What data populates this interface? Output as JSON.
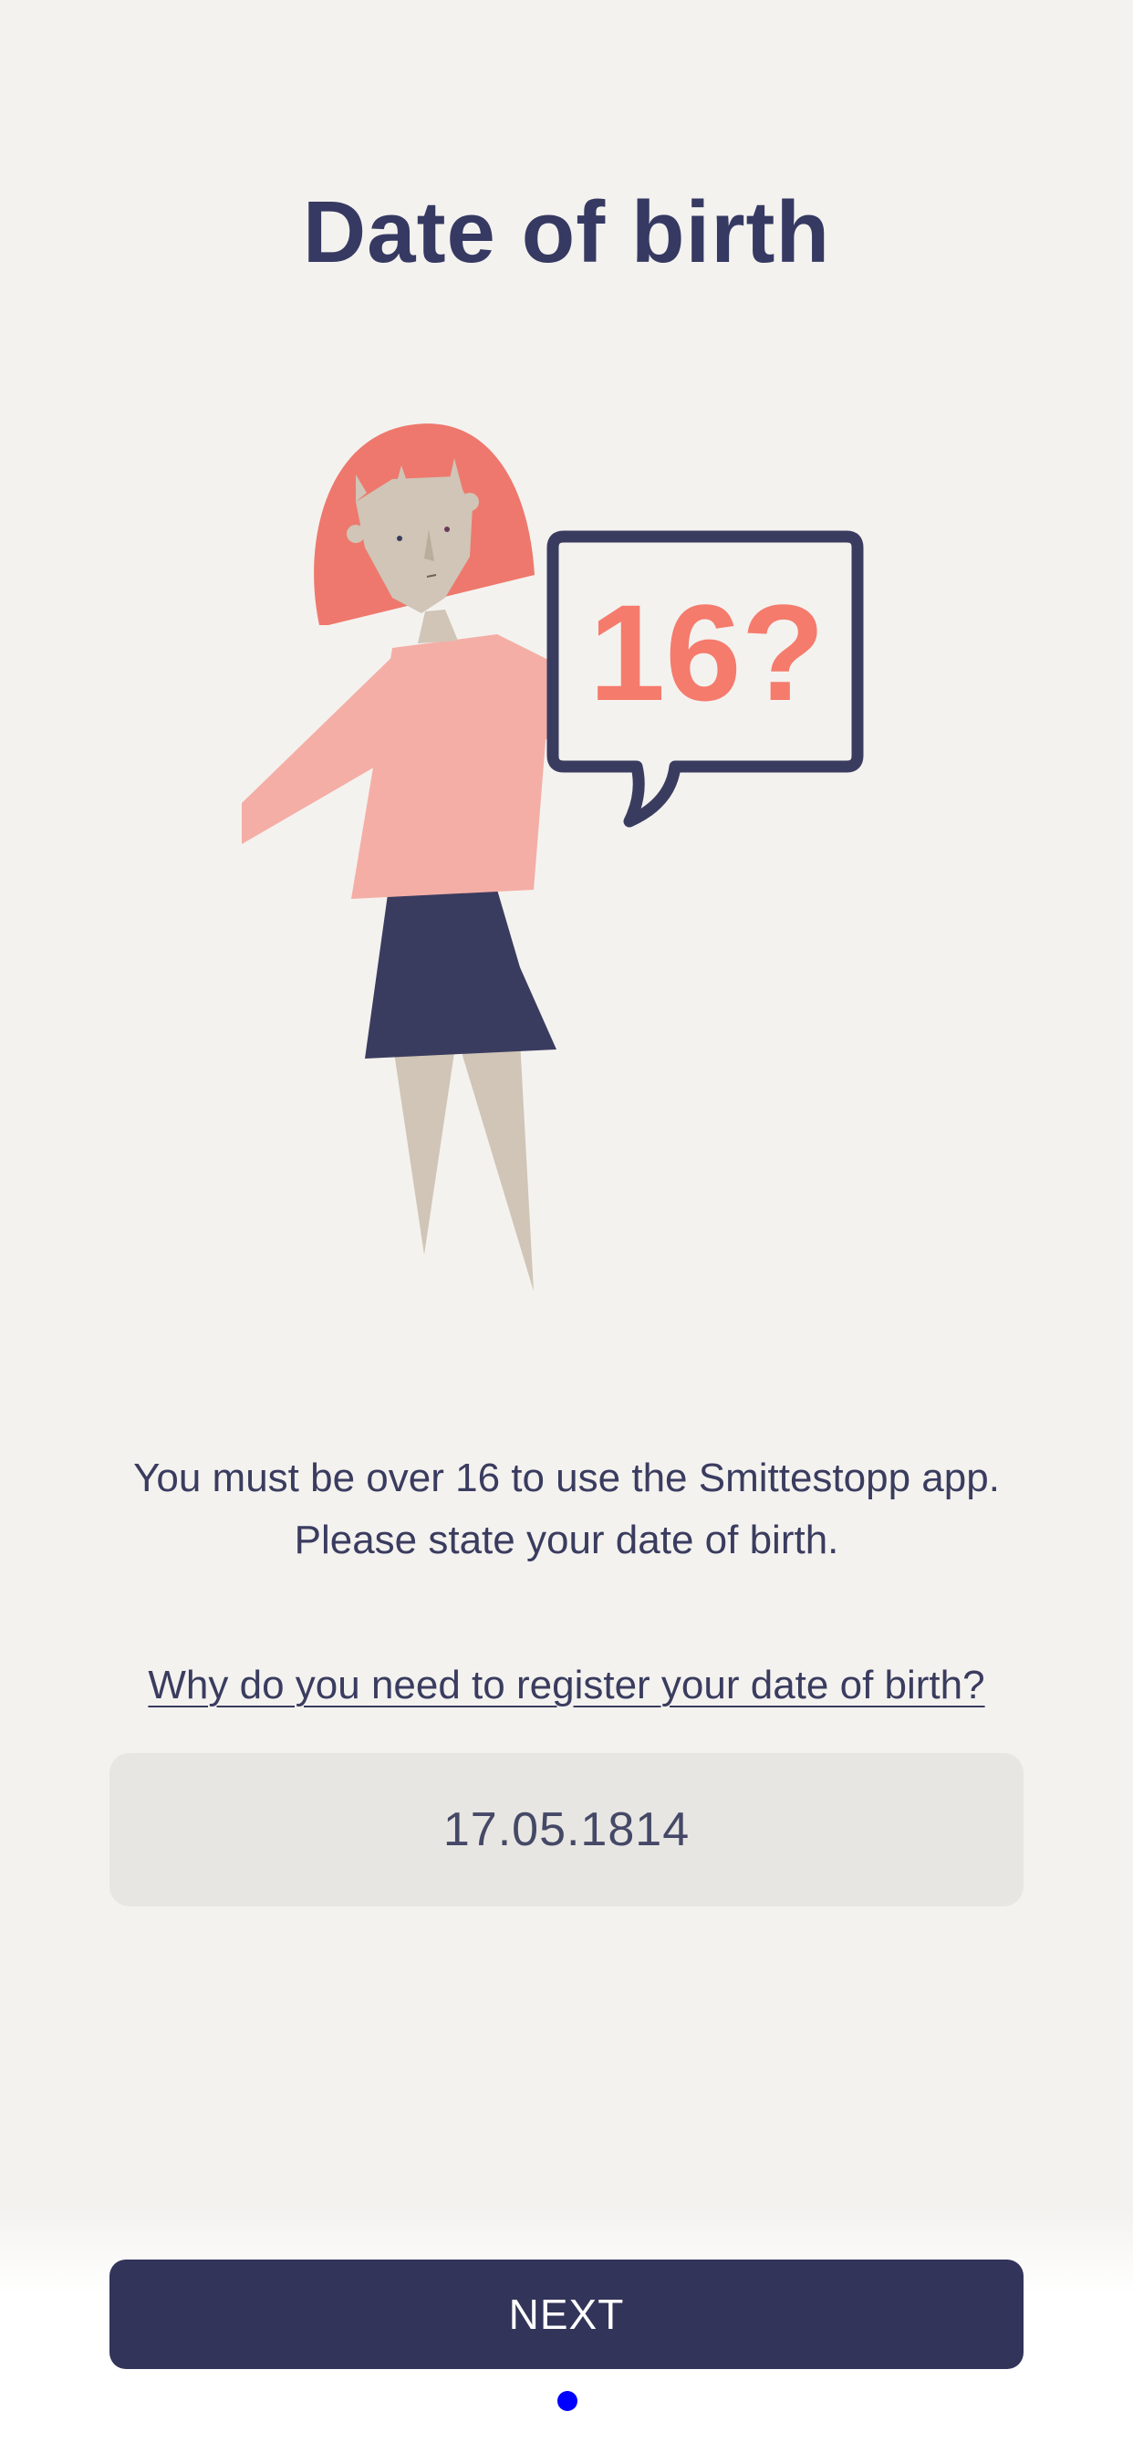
{
  "page": {
    "title": "Date of birth",
    "description_line1": "You must be over 16 to use the Smittestopp app.",
    "description_line2": "Please state your date of birth.",
    "why_link": "Why do you need to register your date of birth?",
    "date_value": "17.05.1814",
    "next_label": "NEXT"
  },
  "illustration": {
    "speech_bubble_text": "16?"
  },
  "colors": {
    "background": "#f4f2ef",
    "title": "#363a62",
    "hair": "#ee786d",
    "sweater": "#f4aea6",
    "skirt": "#3a3c5f",
    "skin": "#d0c5b6",
    "bubble_text": "#f57b6d",
    "button": "#33345a"
  }
}
